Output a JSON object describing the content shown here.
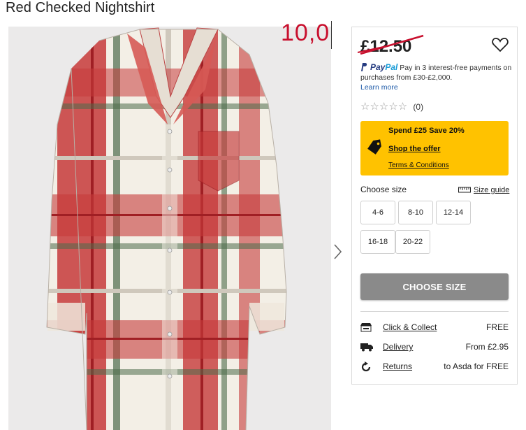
{
  "product": {
    "title": "Red Checked Nightshirt"
  },
  "gallery": {
    "next_arrow_icon": "chevron-right-icon",
    "shirt_colors": {
      "base": "#f3efe6",
      "red": "#c63a3a",
      "dark_red": "#a01f24",
      "green": "#4c6b4a",
      "grey": "#cfc8bc"
    }
  },
  "annotation": {
    "text": "10,0"
  },
  "purchase": {
    "price": "£12.50",
    "wishlist_icon": "heart-icon",
    "paypal": {
      "logo_pay": "Pay",
      "logo_pal": "Pal",
      "text": "Pay in 3 interest-free payments on purchases from £30-£2,000.",
      "learn_more": "Learn more"
    },
    "rating": {
      "stars": "☆☆☆☆☆",
      "count": "(0)"
    },
    "offer": {
      "title": "Spend £25 Save 20%",
      "link": "Shop the offer",
      "terms": "Terms & Conditions",
      "icon": "tag-icon",
      "bg_color": "#ffc200"
    },
    "size": {
      "label": "Choose size",
      "guide": "Size guide",
      "guide_icon": "ruler-icon",
      "options": [
        "4-6",
        "8-10",
        "12-14",
        "16-18",
        "20-22"
      ]
    },
    "cta": {
      "label": "CHOOSE SIZE",
      "color": "#8a8a8a"
    },
    "delivery": [
      {
        "icon": "store-icon",
        "label": "Click & Collect",
        "value": "FREE"
      },
      {
        "icon": "truck-icon",
        "label": "Delivery",
        "value": "From £2.95"
      },
      {
        "icon": "returns-icon",
        "label": "Returns",
        "value": "to Asda for FREE"
      }
    ]
  }
}
